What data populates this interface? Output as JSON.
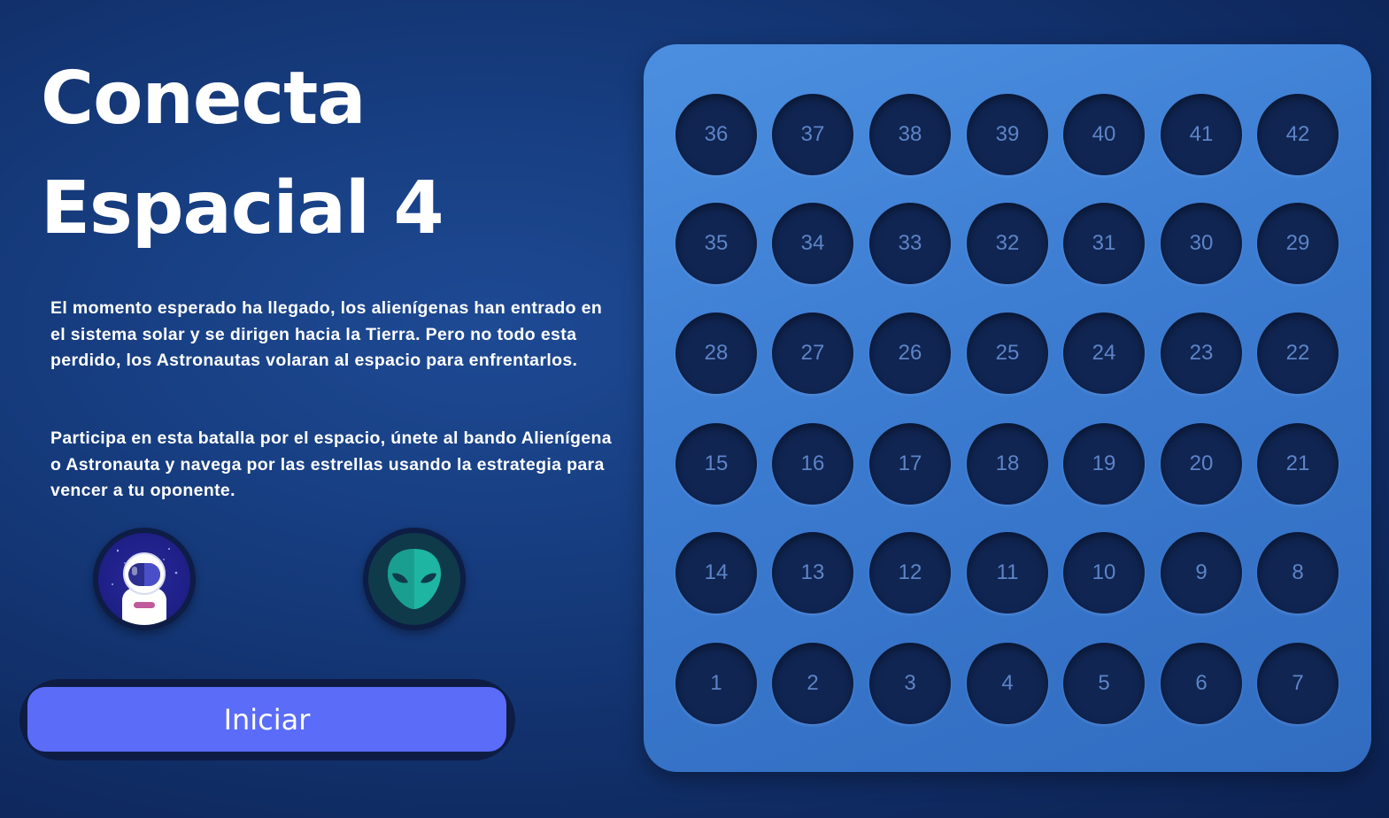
{
  "title": {
    "line1": "Conecta",
    "line2": "Espacial 4"
  },
  "description": {
    "paragraph1": "El momento esperado ha llegado, los alienígenas han entrado en el sistema solar y se dirigen hacia la Tierra. Pero no todo esta perdido, los Astronautas volaran al espacio para enfrentarlos.",
    "paragraph2": "Participa en esta batalla por el espacio, únete al bando Alienígena o Astronauta y navega por las estrellas usando la estrategia para vencer a tu oponente."
  },
  "players": [
    {
      "icon": "astronaut-icon"
    },
    {
      "icon": "alien-icon"
    }
  ],
  "start_button": {
    "label": "Iniciar"
  },
  "colors": {
    "background": "#163c7e",
    "board": "#3b7bd0",
    "cell": "#102552",
    "cell_number": "#5d84c7",
    "button": "#5a6cf8",
    "button_ring": "#0e1c44",
    "alien_green": "#1fb5a3"
  },
  "board": {
    "rows": [
      [
        "36",
        "37",
        "38",
        "39",
        "40",
        "41",
        "42"
      ],
      [
        "35",
        "34",
        "33",
        "32",
        "31",
        "30",
        "29"
      ],
      [
        "28",
        "27",
        "26",
        "25",
        "24",
        "23",
        "22"
      ],
      [
        "15",
        "16",
        "17",
        "18",
        "19",
        "20",
        "21"
      ],
      [
        "14",
        "13",
        "12",
        "11",
        "10",
        "9",
        "8"
      ],
      [
        "1",
        "2",
        "3",
        "4",
        "5",
        "6",
        "7"
      ]
    ]
  }
}
